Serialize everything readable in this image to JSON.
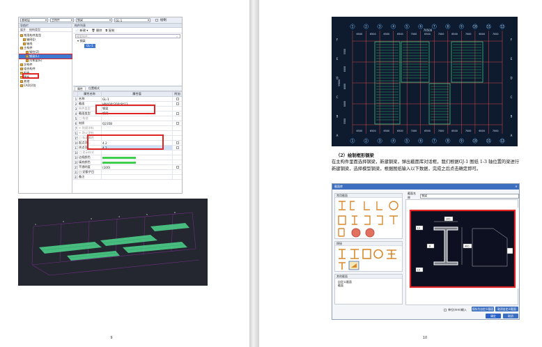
{
  "left": {
    "page_number": "9",
    "toolbar": {
      "floor": "基础层",
      "category": "主构件",
      "type": "钢梁",
      "component": "GL-1",
      "check_label": "绘制"
    },
    "nav_panel": {
      "title": "导航栏",
      "tab1": "展开",
      "tab2": "结构类型"
    },
    "tree": [
      {
        "label": "常用构件类型",
        "indent": 0,
        "selected": false
      },
      {
        "label": "轴网(J)",
        "indent": 1,
        "selected": false
      },
      {
        "label": "轴线",
        "indent": 1,
        "selected": false
      },
      {
        "label": "主构件",
        "indent": 0,
        "selected": false
      },
      {
        "label": "钢柱(Z)",
        "indent": 2,
        "selected": false
      },
      {
        "label": "钢梁(L)",
        "indent": 2,
        "selected": true
      },
      {
        "label": "吊车梁(E)",
        "indent": 2,
        "selected": false
      },
      {
        "label": "次构件",
        "indent": 0,
        "selected": false
      },
      {
        "label": "组合构件",
        "indent": 0,
        "selected": false
      },
      {
        "label": "配件",
        "indent": 0,
        "selected": false
      },
      {
        "label": "围板",
        "indent": 0,
        "selected": false
      },
      {
        "label": "其他",
        "indent": 0,
        "selected": false
      },
      {
        "label": "CAD识别",
        "indent": 0,
        "selected": false
      }
    ],
    "comp_panel": {
      "title": "构件列表",
      "new_label": "新建",
      "delete_label": "删除",
      "copy_label": "复制",
      "search_placeholder": "搜索构件...",
      "group": "钢梁",
      "item": "GL-1"
    },
    "props": {
      "tab_props": "属性",
      "tab_pos": "位置格式",
      "col_name": "属性名称",
      "col_value": "属性值",
      "col_extra": "附加",
      "rows": [
        {
          "no": "1",
          "name": "名称",
          "value": "GL-1",
          "gray": false
        },
        {
          "no": "2",
          "name": "截面",
          "value": "HN400*200*8*13",
          "gray": false
        },
        {
          "no": "3",
          "name": "构件类型",
          "value": "钢梁",
          "gray": true
        },
        {
          "no": "4",
          "name": "截面类型",
          "value": "钢梁",
          "gray": false
        },
        {
          "no": "5",
          "name": "□ 构造",
          "value": "",
          "gray": true
        },
        {
          "no": "6",
          "name": "材质",
          "value": "Q235B",
          "gray": false
        },
        {
          "no": "7",
          "name": "+ 防腐涂料",
          "value": "",
          "gray": true
        },
        {
          "no": "12",
          "name": "+ 防火涂料",
          "value": "",
          "gray": true
        },
        {
          "no": "15",
          "name": "□ 标高属性",
          "value": "",
          "gray": true
        },
        {
          "no": "16",
          "name": "起点顶...",
          "value": "4.2",
          "gray": false
        },
        {
          "no": "17",
          "name": "终点顶...",
          "value": "4.2",
          "gray": false
        },
        {
          "no": "18",
          "name": "□ 显示样式",
          "value": "",
          "gray": true
        },
        {
          "no": "19",
          "name": "边框颜色",
          "value": "",
          "gray": false
        },
        {
          "no": "20",
          "name": "填充颜色",
          "value": "",
          "gray": false
        },
        {
          "no": "21",
          "name": "不透明度",
          "value": "(100)",
          "gray": false
        },
        {
          "no": "22",
          "name": "□ 定额子目",
          "value": "",
          "gray": false
        },
        {
          "no": "23",
          "name": "备注",
          "value": "",
          "gray": false
        }
      ]
    }
  },
  "right": {
    "page_number": "10",
    "plan": {
      "axis_numbers": [
        "1",
        "2",
        "3",
        "4",
        "5",
        "6",
        "7",
        "8",
        "9",
        "10",
        "11",
        "12"
      ],
      "top_spacings": [
        "6500",
        "6500",
        "6500",
        "6500",
        "7000",
        "6500",
        "7000",
        "6500",
        "7000",
        "6000",
        "7000"
      ],
      "overall": "70500",
      "axis_letters": [
        "A",
        "B",
        "C",
        "D",
        "E",
        "F"
      ],
      "side_spacings": [
        "5500",
        "8000",
        "6000",
        "8000",
        "5500"
      ],
      "overall_side": "33000"
    },
    "section_heading": "（2）绘制框形钢梁",
    "paragraph": "在主构件里面选择钢梁，新建钢梁，弹出截面库对话框，我们根据GJ-1 图纸 1-3 轴位置的梁进行新建钢梁，选择模型钢梁，根据图纸输入以下数据，完成之后点击确定即可。",
    "dialog": {
      "title": "截面库",
      "name_label": "截面名称",
      "name_value": "钢梁",
      "group_common": "常用截面",
      "group_weld": "焊接",
      "group_other": "其他截面",
      "other_item": "自定义截面",
      "other_item2": "截面",
      "dim_top": "200",
      "dim_flange": "13",
      "dim_web": "8",
      "dim_height": "400",
      "dim_bottom": "13",
      "checkbox_label": "单位(mm)输入",
      "btn_save": "保存为自定义截面",
      "btn_cancel_lib": "取消自定义截面",
      "btn_ok": "确定",
      "btn_cancel": "取消"
    }
  }
}
